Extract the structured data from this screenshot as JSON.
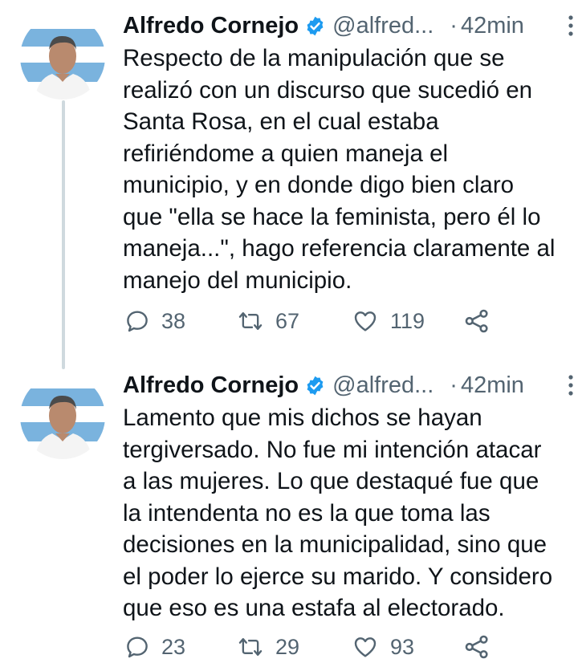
{
  "colors": {
    "text": "#0f1419",
    "secondary": "#536471",
    "verified_badge": "#1d9bf0",
    "thread_line": "#cfd9de"
  },
  "tweets": [
    {
      "author_name": "Alfredo Cornejo",
      "handle": "@alfred...",
      "separator": "·",
      "time": "42min",
      "text": "Respecto de la manipulación que se\nrealizó con un discurso que sucedió en\nSanta Rosa, en el cual estaba\nrefiriéndome a quien maneja el\nmunicipio, y en donde digo bien claro\nque \"ella se hace la feminista, pero él lo\nmaneja...\", hago referencia claramente al\nmanejo del municipio.",
      "replies": "38",
      "retweets": "67",
      "likes": "119"
    },
    {
      "author_name": "Alfredo Cornejo",
      "handle": "@alfred...",
      "separator": "·",
      "time": "42min",
      "text": "Lamento que mis dichos se hayan\ntergiversado. No fue mi intención atacar\na las mujeres. Lo que destaqué fue que\nla intendenta no es la que toma las\ndecisiones en la municipalidad, sino que\nel poder lo ejerce su marido. Y considero\nque eso es una estafa al electorado.",
      "replies": "23",
      "retweets": "29",
      "likes": "93"
    }
  ],
  "icons": {
    "verified": "verified-badge-icon",
    "more": "more-vertical-icon",
    "reply": "reply-icon",
    "retweet": "retweet-icon",
    "like": "heart-icon",
    "share": "share-icon"
  }
}
